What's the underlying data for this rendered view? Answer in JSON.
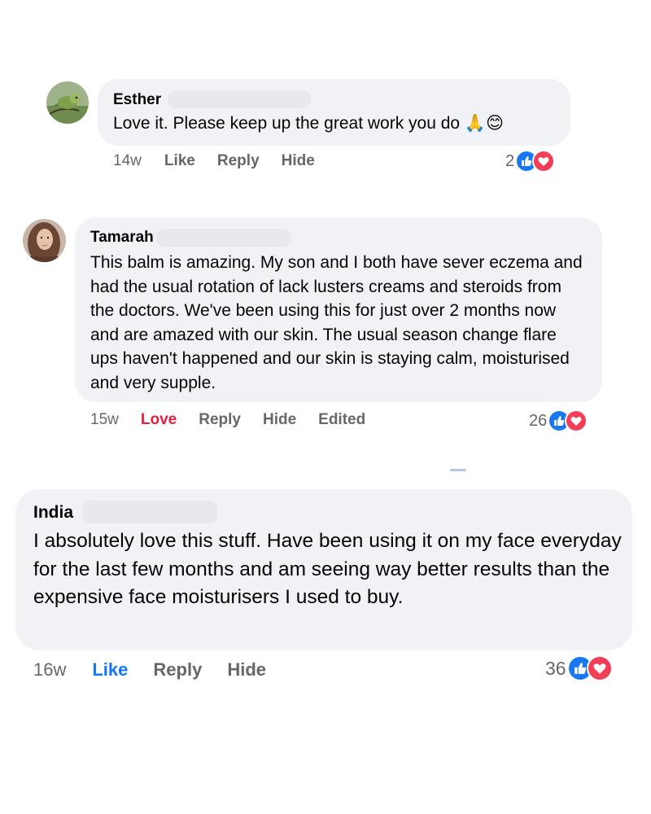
{
  "comments": [
    {
      "author": "Esther",
      "text": "Love it. Please keep up the great work you do 🙏😊",
      "time": "14w",
      "actions": [
        "Like",
        "Reply",
        "Hide"
      ],
      "reaction_count": "2",
      "reactions": [
        "like-icon",
        "love-icon"
      ],
      "avatar": "bird-avatar"
    },
    {
      "author": "Tamarah",
      "text": "This balm is amazing. My son and I both have sever eczema and had the usual rotation of lack lusters creams and steroids from the doctors. We've been using this for just over 2 months now and are amazed with our skin. The usual season change flare ups haven't happened and our skin is staying calm, moisturised and very supple.",
      "time": "15w",
      "actions": [
        "Love",
        "Reply",
        "Hide",
        "Edited"
      ],
      "reaction_count": "26",
      "reactions": [
        "like-icon",
        "love-icon"
      ],
      "avatar": "woman-avatar"
    },
    {
      "author": "India",
      "text": "I absolutely love this stuff. Have been using it on my face everyday for the last few months and am seeing way better results than the expensive face moisturisers I used to buy.",
      "time": "16w",
      "actions": [
        "Like",
        "Reply",
        "Hide"
      ],
      "reaction_count": "36",
      "reactions": [
        "like-icon",
        "love-icon"
      ]
    }
  ],
  "colors": {
    "bubble": "#f0f2f5",
    "meta_gray": "#65676b",
    "love_red": "#e41e3f",
    "like_blue": "#1877f2",
    "reaction_love": "#f33e58"
  }
}
